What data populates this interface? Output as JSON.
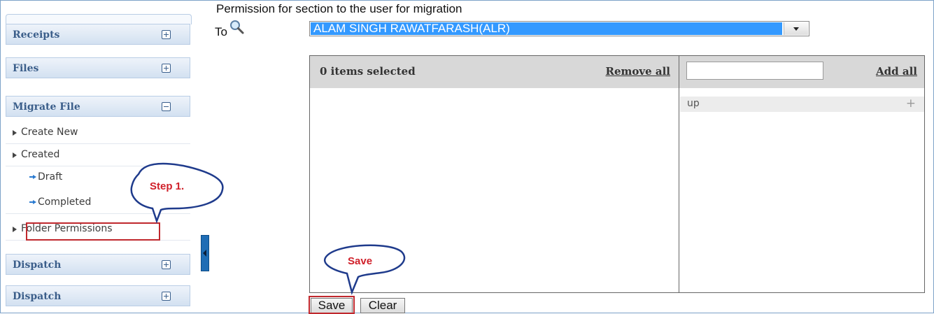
{
  "sidebar": {
    "receipts": "Receipts",
    "files": "Files",
    "migrate_file": "Migrate File",
    "items": [
      {
        "label": "Create New"
      },
      {
        "label": "Created"
      },
      {
        "label": "Draft"
      },
      {
        "label": "Completed"
      },
      {
        "label": "Folder Permissions"
      }
    ],
    "dispatch_1": "Dispatch",
    "dispatch_2": "Dispatch"
  },
  "main": {
    "title": "Permission for section to the user for migration",
    "to_label": "To",
    "user_select_value": "ALAM SINGH RAWATFARASH(ALR)",
    "selected_count": "0 items selected",
    "remove_all": "Remove all",
    "add_all": "Add all",
    "filter_value": "",
    "available_items": [
      {
        "label": "up"
      }
    ],
    "save_label": "Save",
    "clear_label": "Clear"
  },
  "annotations": {
    "step1": "Step 1.",
    "save": "Save"
  },
  "colors": {
    "accent": "#3399ff",
    "callout_border": "#1f3b8c",
    "highlight_red": "#c0282d",
    "sidebar_header_text": "#3b5e8a"
  }
}
